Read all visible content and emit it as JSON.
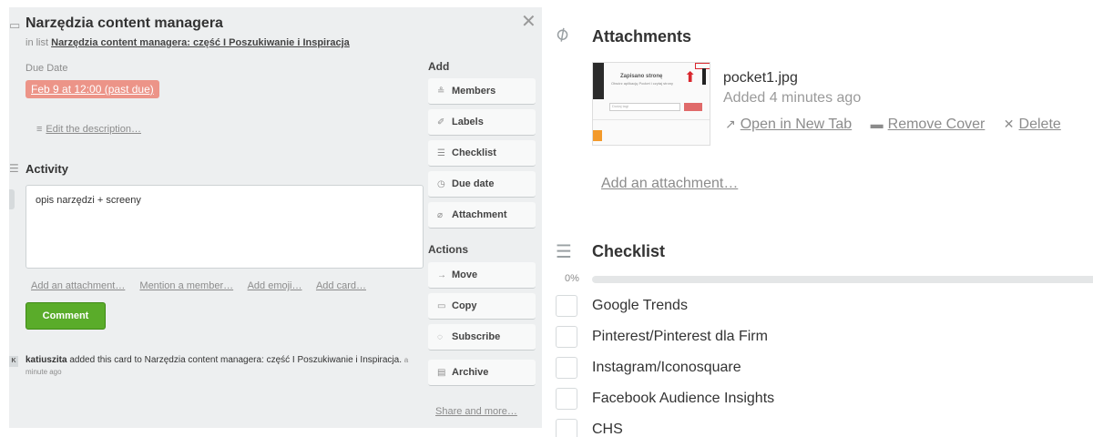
{
  "card": {
    "icon": "card-icon",
    "title": "Narzędzia content managera",
    "list_prefix": "in list",
    "list_name": "Narzędzia content managera: część I Poszukiwanie i Inspiracja",
    "close": "✕"
  },
  "due": {
    "label": "Due Date",
    "value": "Feb 9 at 12:00 (past due)",
    "color": "#ec9488"
  },
  "description": {
    "edit_label": "Edit the description…"
  },
  "activity": {
    "title": "Activity",
    "comment_text": "opis narzędzi + screeny",
    "links": [
      "Add an attachment…",
      "Mention a member…",
      "Add emoji…",
      "Add card…"
    ],
    "comment_button": "Comment",
    "entry": {
      "avatar": "K",
      "user": "katiuszita",
      "text": " added this card to Narzędzia content managera: część I Poszukiwanie i Inspiracja.",
      "ago": "a minute ago"
    }
  },
  "sidebar": {
    "add_heading": "Add",
    "add_buttons": [
      {
        "icon": "members-icon",
        "glyph": "≗",
        "label": "Members"
      },
      {
        "icon": "labels-icon",
        "glyph": "✐",
        "label": "Labels"
      },
      {
        "icon": "checklist-icon",
        "glyph": "☰",
        "label": "Checklist"
      },
      {
        "icon": "clock-icon",
        "glyph": "◷",
        "label": "Due date"
      },
      {
        "icon": "paperclip-icon",
        "glyph": "⌀",
        "label": "Attachment"
      }
    ],
    "actions_heading": "Actions",
    "action_buttons": [
      {
        "icon": "arrow-right-icon",
        "glyph": "→",
        "label": "Move"
      },
      {
        "icon": "copy-icon",
        "glyph": "▭",
        "label": "Copy"
      },
      {
        "icon": "eye-icon",
        "glyph": "◌",
        "label": "Subscribe"
      },
      {
        "icon": "archive-icon",
        "glyph": "▤",
        "label": "Archive"
      }
    ],
    "share_more": "Share and more…"
  },
  "attachments": {
    "title": "Attachments",
    "file": {
      "name": "pocket1.jpg",
      "added": "Added 4 minutes ago",
      "thumb_heading": "Zapisano stronę",
      "thumb_sub": "Otwórz aplikację Pocket i czytaj strony",
      "thumb_input": "Dodaj tagi"
    },
    "actions": [
      {
        "icon": "external-link-icon",
        "glyph": "↗",
        "label": "Open in New Tab"
      },
      {
        "icon": "cover-icon",
        "glyph": "▬",
        "label": "Remove Cover"
      },
      {
        "icon": "delete-icon",
        "glyph": "✕",
        "label": "Delete"
      }
    ],
    "add_label": "Add an attachment…"
  },
  "checklist": {
    "title": "Checklist",
    "progress_label": "0%",
    "progress": 0,
    "items": [
      "Google Trends",
      "Pinterest/Pinterest dla Firm",
      "Instagram/Iconosquare",
      "Facebook Audience Insights",
      "CHS"
    ]
  }
}
